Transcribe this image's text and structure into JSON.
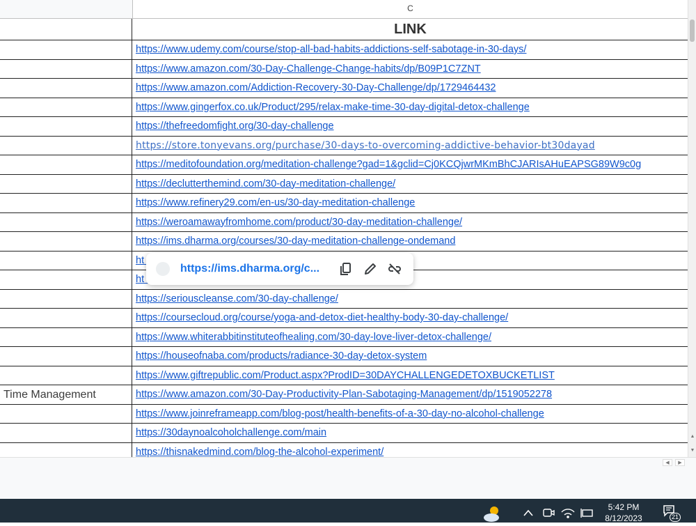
{
  "column_header": {
    "c": "C"
  },
  "header": {
    "link": "LINK"
  },
  "rows": [
    {
      "a": "",
      "c": "https://www.udemy.com/course/stop-all-bad-habits-addictions-self-sabotage-in-30-days/"
    },
    {
      "a": "",
      "c": "https://www.amazon.com/30-Day-Challenge-Change-habits/dp/B09P1C7ZNT"
    },
    {
      "a": "",
      "c": "https://www.amazon.com/Addiction-Recovery-30-Day-Challenge/dp/1729464432"
    },
    {
      "a": "",
      "c": "https://www.gingerfox.co.uk/Product/295/relax-make-time-30-day-digital-detox-challenge"
    },
    {
      "a": "",
      "c": "https://thefreedomfight.org/30-day-challenge"
    },
    {
      "a": "",
      "c": "https://store.tonyevans.org/purchase/30-days-to-overcoming-addictive-behavior-bt30dayad"
    },
    {
      "a": "",
      "c": "https://meditofoundation.org/meditation-challenge?gad=1&gclid=Cj0KCQjwrMKmBhCJARIsAHuEAPSG89W9c0g"
    },
    {
      "a": "",
      "c": "https://declutterthemind.com/30-day-meditation-challenge/"
    },
    {
      "a": "",
      "c": "https://www.refinery29.com/en-us/30-day-meditation-challenge"
    },
    {
      "a": "",
      "c": "https://weroamawayfromhome.com/product/30-day-meditation-challenge/"
    },
    {
      "a": "",
      "c": "https://ims.dharma.org/courses/30-day-meditation-challenge-ondemand"
    },
    {
      "a": "",
      "c": "ht                                                                                   enge/"
    },
    {
      "a": "",
      "c": "ht                                                                                   g/"
    },
    {
      "a": "",
      "c": "https://seriouscleanse.com/30-day-challenge/"
    },
    {
      "a": "",
      "c": "https://coursecloud.org/course/yoga-and-detox-diet-healthy-body-30-day-challenge/"
    },
    {
      "a": "",
      "c": "https://www.whiterabbitinstituteofhealing.com/30-day-love-liver-detox-challenge/"
    },
    {
      "a": "",
      "c": "https://houseofnaba.com/products/radiance-30-day-detox-system"
    },
    {
      "a": "",
      "c": "https://www.giftrepublic.com/Product.aspx?ProdID=30DAYCHALLENGEDETOXBUCKETLIST"
    },
    {
      "a": "Time Management",
      "c": "https://www.amazon.com/30-Day-Productivity-Plan-Sabotaging-Management/dp/1519052278"
    },
    {
      "a": "",
      "c": "https://www.joinreframeapp.com/blog-post/health-benefits-of-a-30-day-no-alcohol-challenge"
    },
    {
      "a": "",
      "c": "https://30daynoalcoholchallenge.com/main"
    },
    {
      "a": "",
      "c": "https://thisnakedmind.com/blog-the-alcohol-experiment/"
    }
  ],
  "popup": {
    "url": "https://ims.dharma.org/c..."
  },
  "taskbar": {
    "time": "5:42 PM",
    "date": "8/12/2023",
    "notifications": "21"
  }
}
